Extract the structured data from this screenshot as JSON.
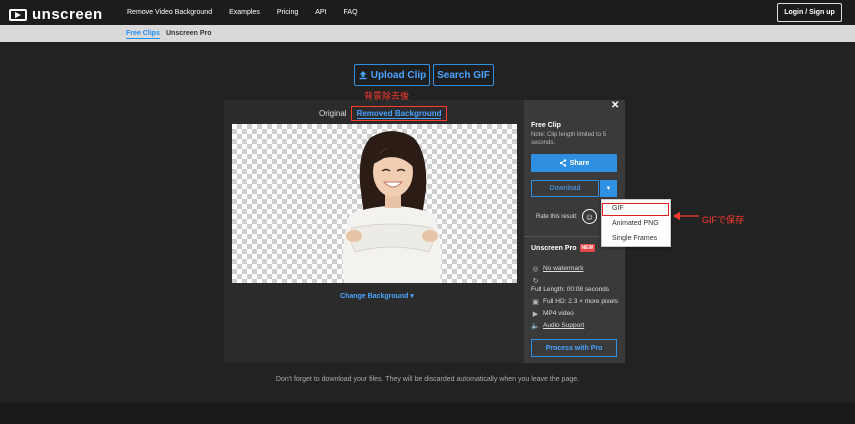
{
  "brand": {
    "name": "unscreen"
  },
  "nav": {
    "items": [
      "Remove Video Background",
      "Examples",
      "Pricing",
      "API",
      "FAQ"
    ],
    "login": "Login / Sign up"
  },
  "subnav": {
    "items": [
      "Free Clips",
      "Unscreen Pro"
    ],
    "active": "Free Clips"
  },
  "actions": {
    "upload": "Upload Clip",
    "search": "Search GIF"
  },
  "annotations": {
    "removed_note": "背景除去後",
    "gif_note": "GIFで保存"
  },
  "editor": {
    "tab_original": "Original",
    "tab_removed": "Removed Background",
    "change_background": "Change Background"
  },
  "sidebar": {
    "title": "Free Clip",
    "note": "Note: Clip length limited to 5 seconds.",
    "share": "Share",
    "download": "Download",
    "rate": "Rate this result:",
    "pro_title": "Unscreen Pro",
    "pro_badge": "NEW",
    "features": [
      {
        "icon": "watermark-icon",
        "label": "No watermark"
      },
      {
        "icon": "clock-icon",
        "label": ""
      },
      {
        "icon": "length-icon",
        "label": "Full Length: 00:08 seconds"
      },
      {
        "icon": "hd-icon",
        "label": "Full HD: 2.3 × more pixels"
      },
      {
        "icon": "video-icon",
        "label": "MP4 video"
      },
      {
        "icon": "audio-icon",
        "label": "Audio Support"
      }
    ],
    "process": "Process with Pro"
  },
  "download_menu": {
    "options": [
      "GIF",
      "Animated PNG",
      "Single Frames"
    ]
  },
  "footer": {
    "note": "Don't forget to download your files. They will be discarded automatically when you leave the page."
  },
  "colors": {
    "accent": "#2f8fe0",
    "annotation": "#ff3b30",
    "background": "#222222"
  }
}
